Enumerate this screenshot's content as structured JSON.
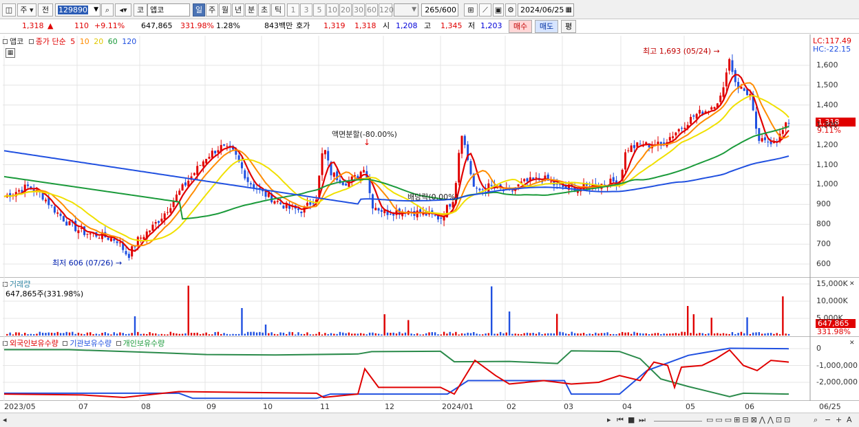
{
  "toolbar": {
    "market": "주",
    "prev": "전",
    "code": "129890",
    "type": "코",
    "name": "앱코",
    "periods": [
      "일",
      "주",
      "월",
      "년",
      "분",
      "초",
      "틱"
    ],
    "intervals": [
      "1",
      "3",
      "5",
      "10",
      "20",
      "30",
      "60",
      "120"
    ],
    "count": "265",
    "count_total": "/600",
    "date": "2024/06/25"
  },
  "quote": {
    "price": "1,318",
    "arrow": "▲",
    "change": "110",
    "change_pct": "+9.11%",
    "volume": "647,865",
    "volume_pct": "331.98%",
    "turnover": "1.28%",
    "amount": "843백만",
    "bid_label": "호가",
    "ask": "1,319",
    "bid": "1,318",
    "open_label": "시",
    "open": "1,208",
    "high_label": "고",
    "high": "1,345",
    "low_label": "저",
    "low": "1,203",
    "buy_label": "매수",
    "sell_label": "매도",
    "eval_label": "평"
  },
  "price_panel": {
    "name": "앱코",
    "legend_prefix": "종가 단순",
    "ma": [
      {
        "period": "5",
        "color": "#e00000"
      },
      {
        "period": "10",
        "color": "#ff8c00"
      },
      {
        "period": "20",
        "color": "#f0e000"
      },
      {
        "period": "60",
        "color": "#1a9a3a"
      },
      {
        "period": "120",
        "color": "#2050e0"
      }
    ],
    "lc": "LC:117.49",
    "hc": "HC:-22.15",
    "current_tag": "1,318",
    "current_pct": "9.11%",
    "high_note": "최고 1,693 (05/24)",
    "low_note": "최저 606 (07/26)",
    "split_note": "액면분할(-80.00%)",
    "div_note": "배당락(0.00%)",
    "y_ticks": [
      "1,600",
      "1,500",
      "1,400",
      "1,300",
      "1,200",
      "1,100",
      "1,000",
      "900",
      "800",
      "700",
      "600"
    ]
  },
  "volume_panel": {
    "title": "거래량",
    "value": "647,865주(331.98%)",
    "y_ticks": [
      "15,000K",
      "10,000K",
      "5,000K"
    ],
    "current_tag": "647,865",
    "current_pct": "331.98%"
  },
  "holding_panel": {
    "legends": [
      "외국인보유수량",
      "기관보유수량",
      "개인보유수량"
    ],
    "legend_colors": [
      "#e00000",
      "#2050e0",
      "#1a9a3a"
    ],
    "y_ticks": [
      "0",
      "-1,000,000",
      "-2,000,000"
    ]
  },
  "x_axis": [
    "2023/05",
    "07",
    "08",
    "09",
    "10",
    "11",
    "12",
    "2024/01",
    "02",
    "03",
    "04",
    "05",
    "06",
    "06/25"
  ],
  "chart_data": {
    "type": "line",
    "title": "앱코",
    "x": [
      "2023/05",
      "07",
      "08",
      "09",
      "10",
      "11",
      "12",
      "2024/01",
      "02",
      "03",
      "04",
      "05",
      "06",
      "06/25"
    ],
    "ylim": [
      560,
      1700
    ],
    "series": [
      {
        "name": "5",
        "values": [
          940,
          720,
          850,
          1180,
          910,
          1000,
          860,
          1100,
          950,
          1010,
          1150,
          1300,
          1318
        ]
      },
      {
        "name": "10",
        "values": [
          950,
          740,
          830,
          1160,
          920,
          980,
          870,
          1060,
          960,
          1000,
          1130,
          1330,
          1260
        ]
      },
      {
        "name": "20",
        "values": [
          960,
          760,
          800,
          1120,
          940,
          960,
          880,
          990,
          980,
          1000,
          1080,
          1380,
          1350
        ]
      },
      {
        "name": "60",
        "values": [
          1040,
          900,
          830,
          890,
          960,
          1020,
          960,
          970,
          960,
          960,
          1030,
          1150,
          1280
        ]
      },
      {
        "name": "120",
        "values": [
          1170,
          1080,
          950,
          900,
          900,
          920,
          940,
          960,
          950,
          960,
          980,
          1050,
          1140
        ]
      }
    ],
    "annotations": [
      "최고 1,693 (05/24)",
      "최저 606 (07/26)",
      "액면분할(-80.00%)",
      "배당락(0.00%)"
    ]
  }
}
